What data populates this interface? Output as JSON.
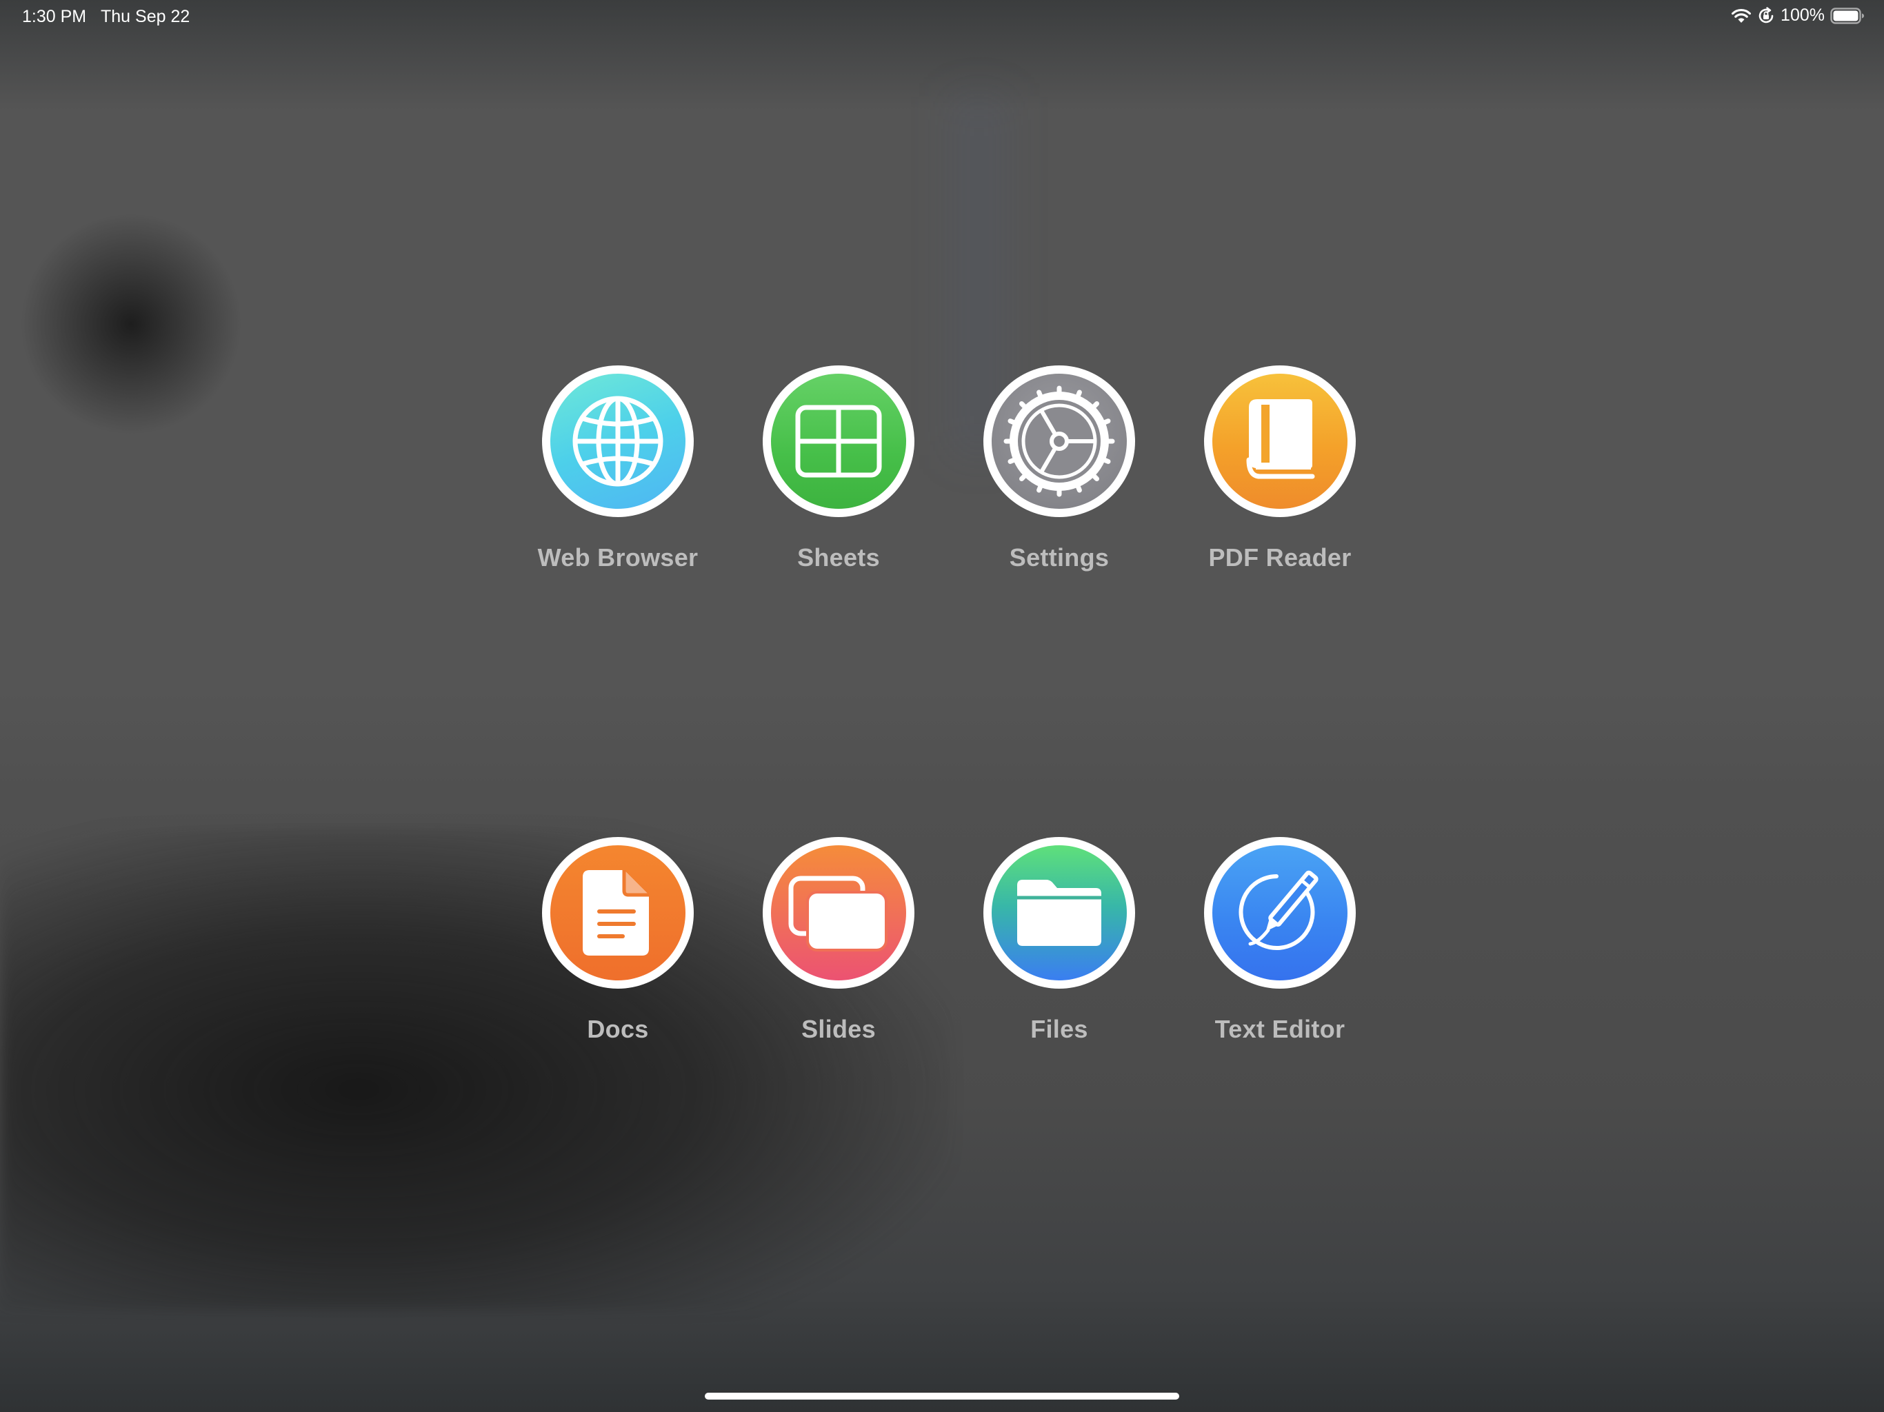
{
  "status_bar": {
    "time": "1:30 PM",
    "date": "Thu Sep 22",
    "battery": "100%",
    "icons": [
      "wifi-icon",
      "orientation-lock-icon",
      "battery-icon"
    ]
  },
  "apps": [
    {
      "label": "Web Browser",
      "icon": "globe-icon",
      "color": "#4fd6e4"
    },
    {
      "label": "Sheets",
      "icon": "grid-icon",
      "color": "#49c34b"
    },
    {
      "label": "Settings",
      "icon": "gear-icon",
      "color": "#8e8e93"
    },
    {
      "label": "PDF Reader",
      "icon": "book-icon",
      "color": "#f4a326"
    },
    {
      "label": "Docs",
      "icon": "document-icon",
      "color": "#f07a26"
    },
    {
      "label": "Slides",
      "icon": "slides-icon",
      "color": "#ef6a55"
    },
    {
      "label": "Files",
      "icon": "folder-icon",
      "color": "#3b89f0"
    },
    {
      "label": "Text Editor",
      "icon": "pencil-circle-icon",
      "color": "#3a86f1"
    }
  ]
}
